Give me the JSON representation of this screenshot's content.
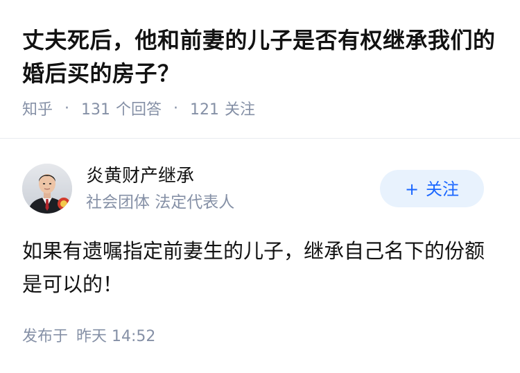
{
  "question": {
    "title": "丈夫死后，他和前妻的儿子是否有权继承我们的婚后买的房子？",
    "source": "知乎",
    "separator": "·",
    "answer_count": "131",
    "answer_label": "个回答",
    "follower_count": "121",
    "follower_label": "关注"
  },
  "answer": {
    "author": {
      "name": "炎黄财产继承",
      "description": "社会团体 法定代表人",
      "avatar_icon": "user-avatar-photo"
    },
    "follow_button": {
      "plus": "+",
      "label": "关注"
    },
    "content": "如果有遗嘱指定前妻生的儿子，继承自己名下的份额是可以的！",
    "time_prefix": "发布于",
    "time_value": "昨天 14:52"
  },
  "colors": {
    "title": "#121212",
    "meta": "#8590a6",
    "accent": "#1a66ff",
    "button_bg": "#e8f2fd",
    "divider": "#e8ebef"
  }
}
